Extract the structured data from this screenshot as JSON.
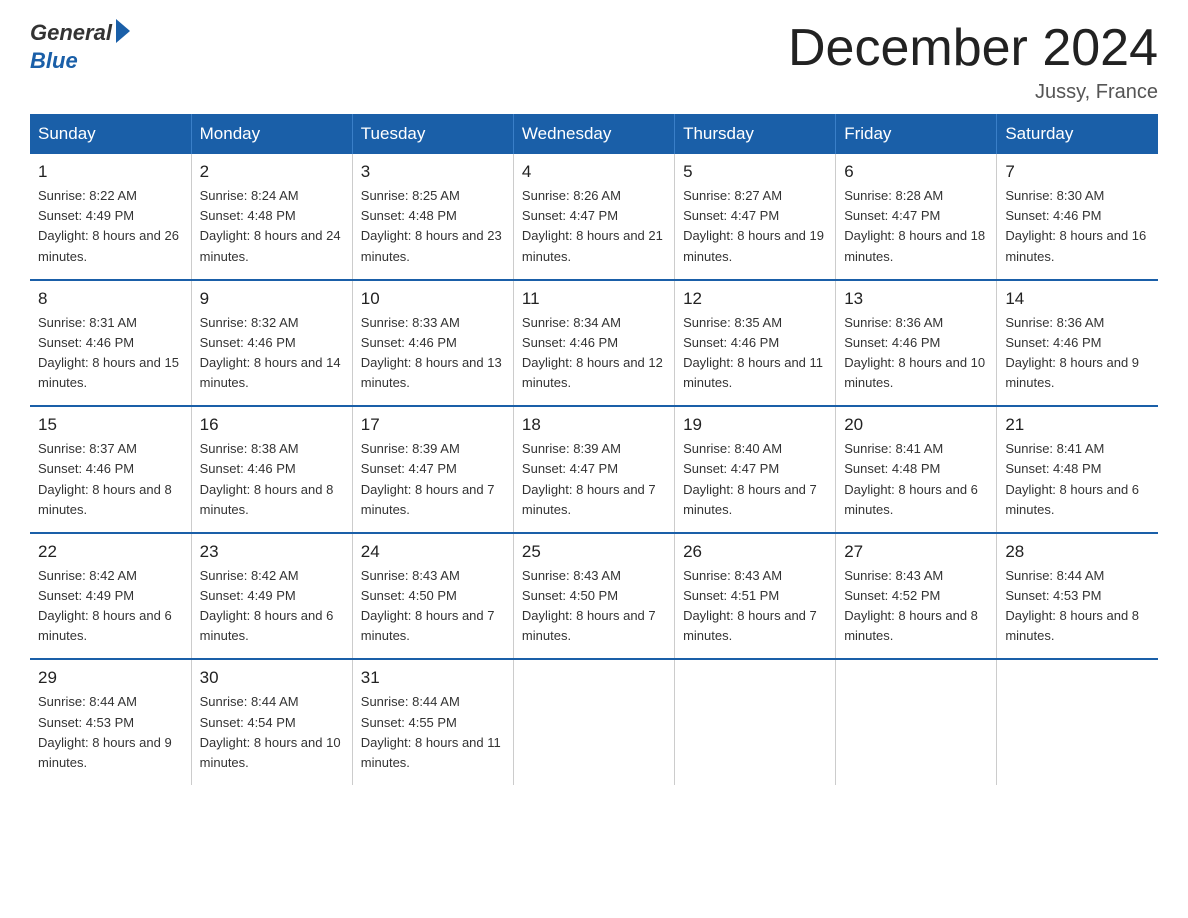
{
  "logo": {
    "general": "General",
    "blue": "Blue"
  },
  "title": "December 2024",
  "location": "Jussy, France",
  "days_header": [
    "Sunday",
    "Monday",
    "Tuesday",
    "Wednesday",
    "Thursday",
    "Friday",
    "Saturday"
  ],
  "weeks": [
    [
      {
        "day": "1",
        "sunrise": "8:22 AM",
        "sunset": "4:49 PM",
        "daylight": "8 hours and 26 minutes."
      },
      {
        "day": "2",
        "sunrise": "8:24 AM",
        "sunset": "4:48 PM",
        "daylight": "8 hours and 24 minutes."
      },
      {
        "day": "3",
        "sunrise": "8:25 AM",
        "sunset": "4:48 PM",
        "daylight": "8 hours and 23 minutes."
      },
      {
        "day": "4",
        "sunrise": "8:26 AM",
        "sunset": "4:47 PM",
        "daylight": "8 hours and 21 minutes."
      },
      {
        "day": "5",
        "sunrise": "8:27 AM",
        "sunset": "4:47 PM",
        "daylight": "8 hours and 19 minutes."
      },
      {
        "day": "6",
        "sunrise": "8:28 AM",
        "sunset": "4:47 PM",
        "daylight": "8 hours and 18 minutes."
      },
      {
        "day": "7",
        "sunrise": "8:30 AM",
        "sunset": "4:46 PM",
        "daylight": "8 hours and 16 minutes."
      }
    ],
    [
      {
        "day": "8",
        "sunrise": "8:31 AM",
        "sunset": "4:46 PM",
        "daylight": "8 hours and 15 minutes."
      },
      {
        "day": "9",
        "sunrise": "8:32 AM",
        "sunset": "4:46 PM",
        "daylight": "8 hours and 14 minutes."
      },
      {
        "day": "10",
        "sunrise": "8:33 AM",
        "sunset": "4:46 PM",
        "daylight": "8 hours and 13 minutes."
      },
      {
        "day": "11",
        "sunrise": "8:34 AM",
        "sunset": "4:46 PM",
        "daylight": "8 hours and 12 minutes."
      },
      {
        "day": "12",
        "sunrise": "8:35 AM",
        "sunset": "4:46 PM",
        "daylight": "8 hours and 11 minutes."
      },
      {
        "day": "13",
        "sunrise": "8:36 AM",
        "sunset": "4:46 PM",
        "daylight": "8 hours and 10 minutes."
      },
      {
        "day": "14",
        "sunrise": "8:36 AM",
        "sunset": "4:46 PM",
        "daylight": "8 hours and 9 minutes."
      }
    ],
    [
      {
        "day": "15",
        "sunrise": "8:37 AM",
        "sunset": "4:46 PM",
        "daylight": "8 hours and 8 minutes."
      },
      {
        "day": "16",
        "sunrise": "8:38 AM",
        "sunset": "4:46 PM",
        "daylight": "8 hours and 8 minutes."
      },
      {
        "day": "17",
        "sunrise": "8:39 AM",
        "sunset": "4:47 PM",
        "daylight": "8 hours and 7 minutes."
      },
      {
        "day": "18",
        "sunrise": "8:39 AM",
        "sunset": "4:47 PM",
        "daylight": "8 hours and 7 minutes."
      },
      {
        "day": "19",
        "sunrise": "8:40 AM",
        "sunset": "4:47 PM",
        "daylight": "8 hours and 7 minutes."
      },
      {
        "day": "20",
        "sunrise": "8:41 AM",
        "sunset": "4:48 PM",
        "daylight": "8 hours and 6 minutes."
      },
      {
        "day": "21",
        "sunrise": "8:41 AM",
        "sunset": "4:48 PM",
        "daylight": "8 hours and 6 minutes."
      }
    ],
    [
      {
        "day": "22",
        "sunrise": "8:42 AM",
        "sunset": "4:49 PM",
        "daylight": "8 hours and 6 minutes."
      },
      {
        "day": "23",
        "sunrise": "8:42 AM",
        "sunset": "4:49 PM",
        "daylight": "8 hours and 6 minutes."
      },
      {
        "day": "24",
        "sunrise": "8:43 AM",
        "sunset": "4:50 PM",
        "daylight": "8 hours and 7 minutes."
      },
      {
        "day": "25",
        "sunrise": "8:43 AM",
        "sunset": "4:50 PM",
        "daylight": "8 hours and 7 minutes."
      },
      {
        "day": "26",
        "sunrise": "8:43 AM",
        "sunset": "4:51 PM",
        "daylight": "8 hours and 7 minutes."
      },
      {
        "day": "27",
        "sunrise": "8:43 AM",
        "sunset": "4:52 PM",
        "daylight": "8 hours and 8 minutes."
      },
      {
        "day": "28",
        "sunrise": "8:44 AM",
        "sunset": "4:53 PM",
        "daylight": "8 hours and 8 minutes."
      }
    ],
    [
      {
        "day": "29",
        "sunrise": "8:44 AM",
        "sunset": "4:53 PM",
        "daylight": "8 hours and 9 minutes."
      },
      {
        "day": "30",
        "sunrise": "8:44 AM",
        "sunset": "4:54 PM",
        "daylight": "8 hours and 10 minutes."
      },
      {
        "day": "31",
        "sunrise": "8:44 AM",
        "sunset": "4:55 PM",
        "daylight": "8 hours and 11 minutes."
      },
      null,
      null,
      null,
      null
    ]
  ]
}
